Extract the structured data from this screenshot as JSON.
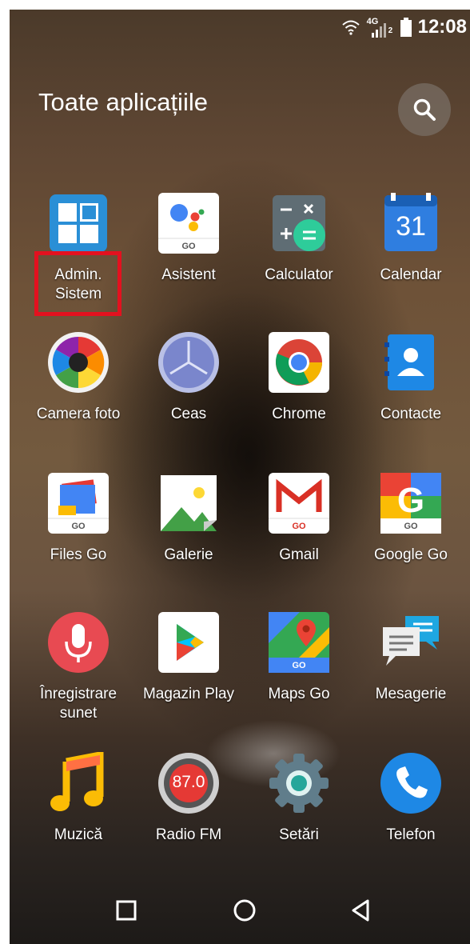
{
  "status_bar": {
    "time": "12:08",
    "network": "4G",
    "sim": "2"
  },
  "header": {
    "title": "Toate aplicațiile"
  },
  "apps": [
    {
      "label": "Admin.\nSistem",
      "icon": "windows-tiles-icon"
    },
    {
      "label": "Asistent",
      "icon": "google-assistant-go-icon"
    },
    {
      "label": "Calculator",
      "icon": "calculator-icon"
    },
    {
      "label": "Calendar",
      "icon": "calendar-icon",
      "day": "31"
    },
    {
      "label": "Camera foto",
      "icon": "camera-aperture-icon"
    },
    {
      "label": "Ceas",
      "icon": "clock-icon"
    },
    {
      "label": "Chrome",
      "icon": "chrome-icon"
    },
    {
      "label": "Contacte",
      "icon": "contacts-icon"
    },
    {
      "label": "Files Go",
      "icon": "files-go-icon"
    },
    {
      "label": "Galerie",
      "icon": "gallery-icon"
    },
    {
      "label": "Gmail",
      "icon": "gmail-go-icon"
    },
    {
      "label": "Google Go",
      "icon": "google-go-icon"
    },
    {
      "label": "Înregistrare\nsunet",
      "icon": "microphone-icon"
    },
    {
      "label": "Magazin Play",
      "icon": "play-store-icon"
    },
    {
      "label": "Maps Go",
      "icon": "maps-go-icon"
    },
    {
      "label": "Mesagerie",
      "icon": "messaging-icon"
    },
    {
      "label": "Muzică",
      "icon": "music-icon"
    },
    {
      "label": "Radio FM",
      "icon": "radio-icon",
      "frequency": "87.0"
    },
    {
      "label": "Setări",
      "icon": "settings-gear-icon"
    },
    {
      "label": "Telefon",
      "icon": "phone-icon"
    }
  ],
  "go_badge": "GO",
  "colors": {
    "highlight": "#e3111f"
  }
}
